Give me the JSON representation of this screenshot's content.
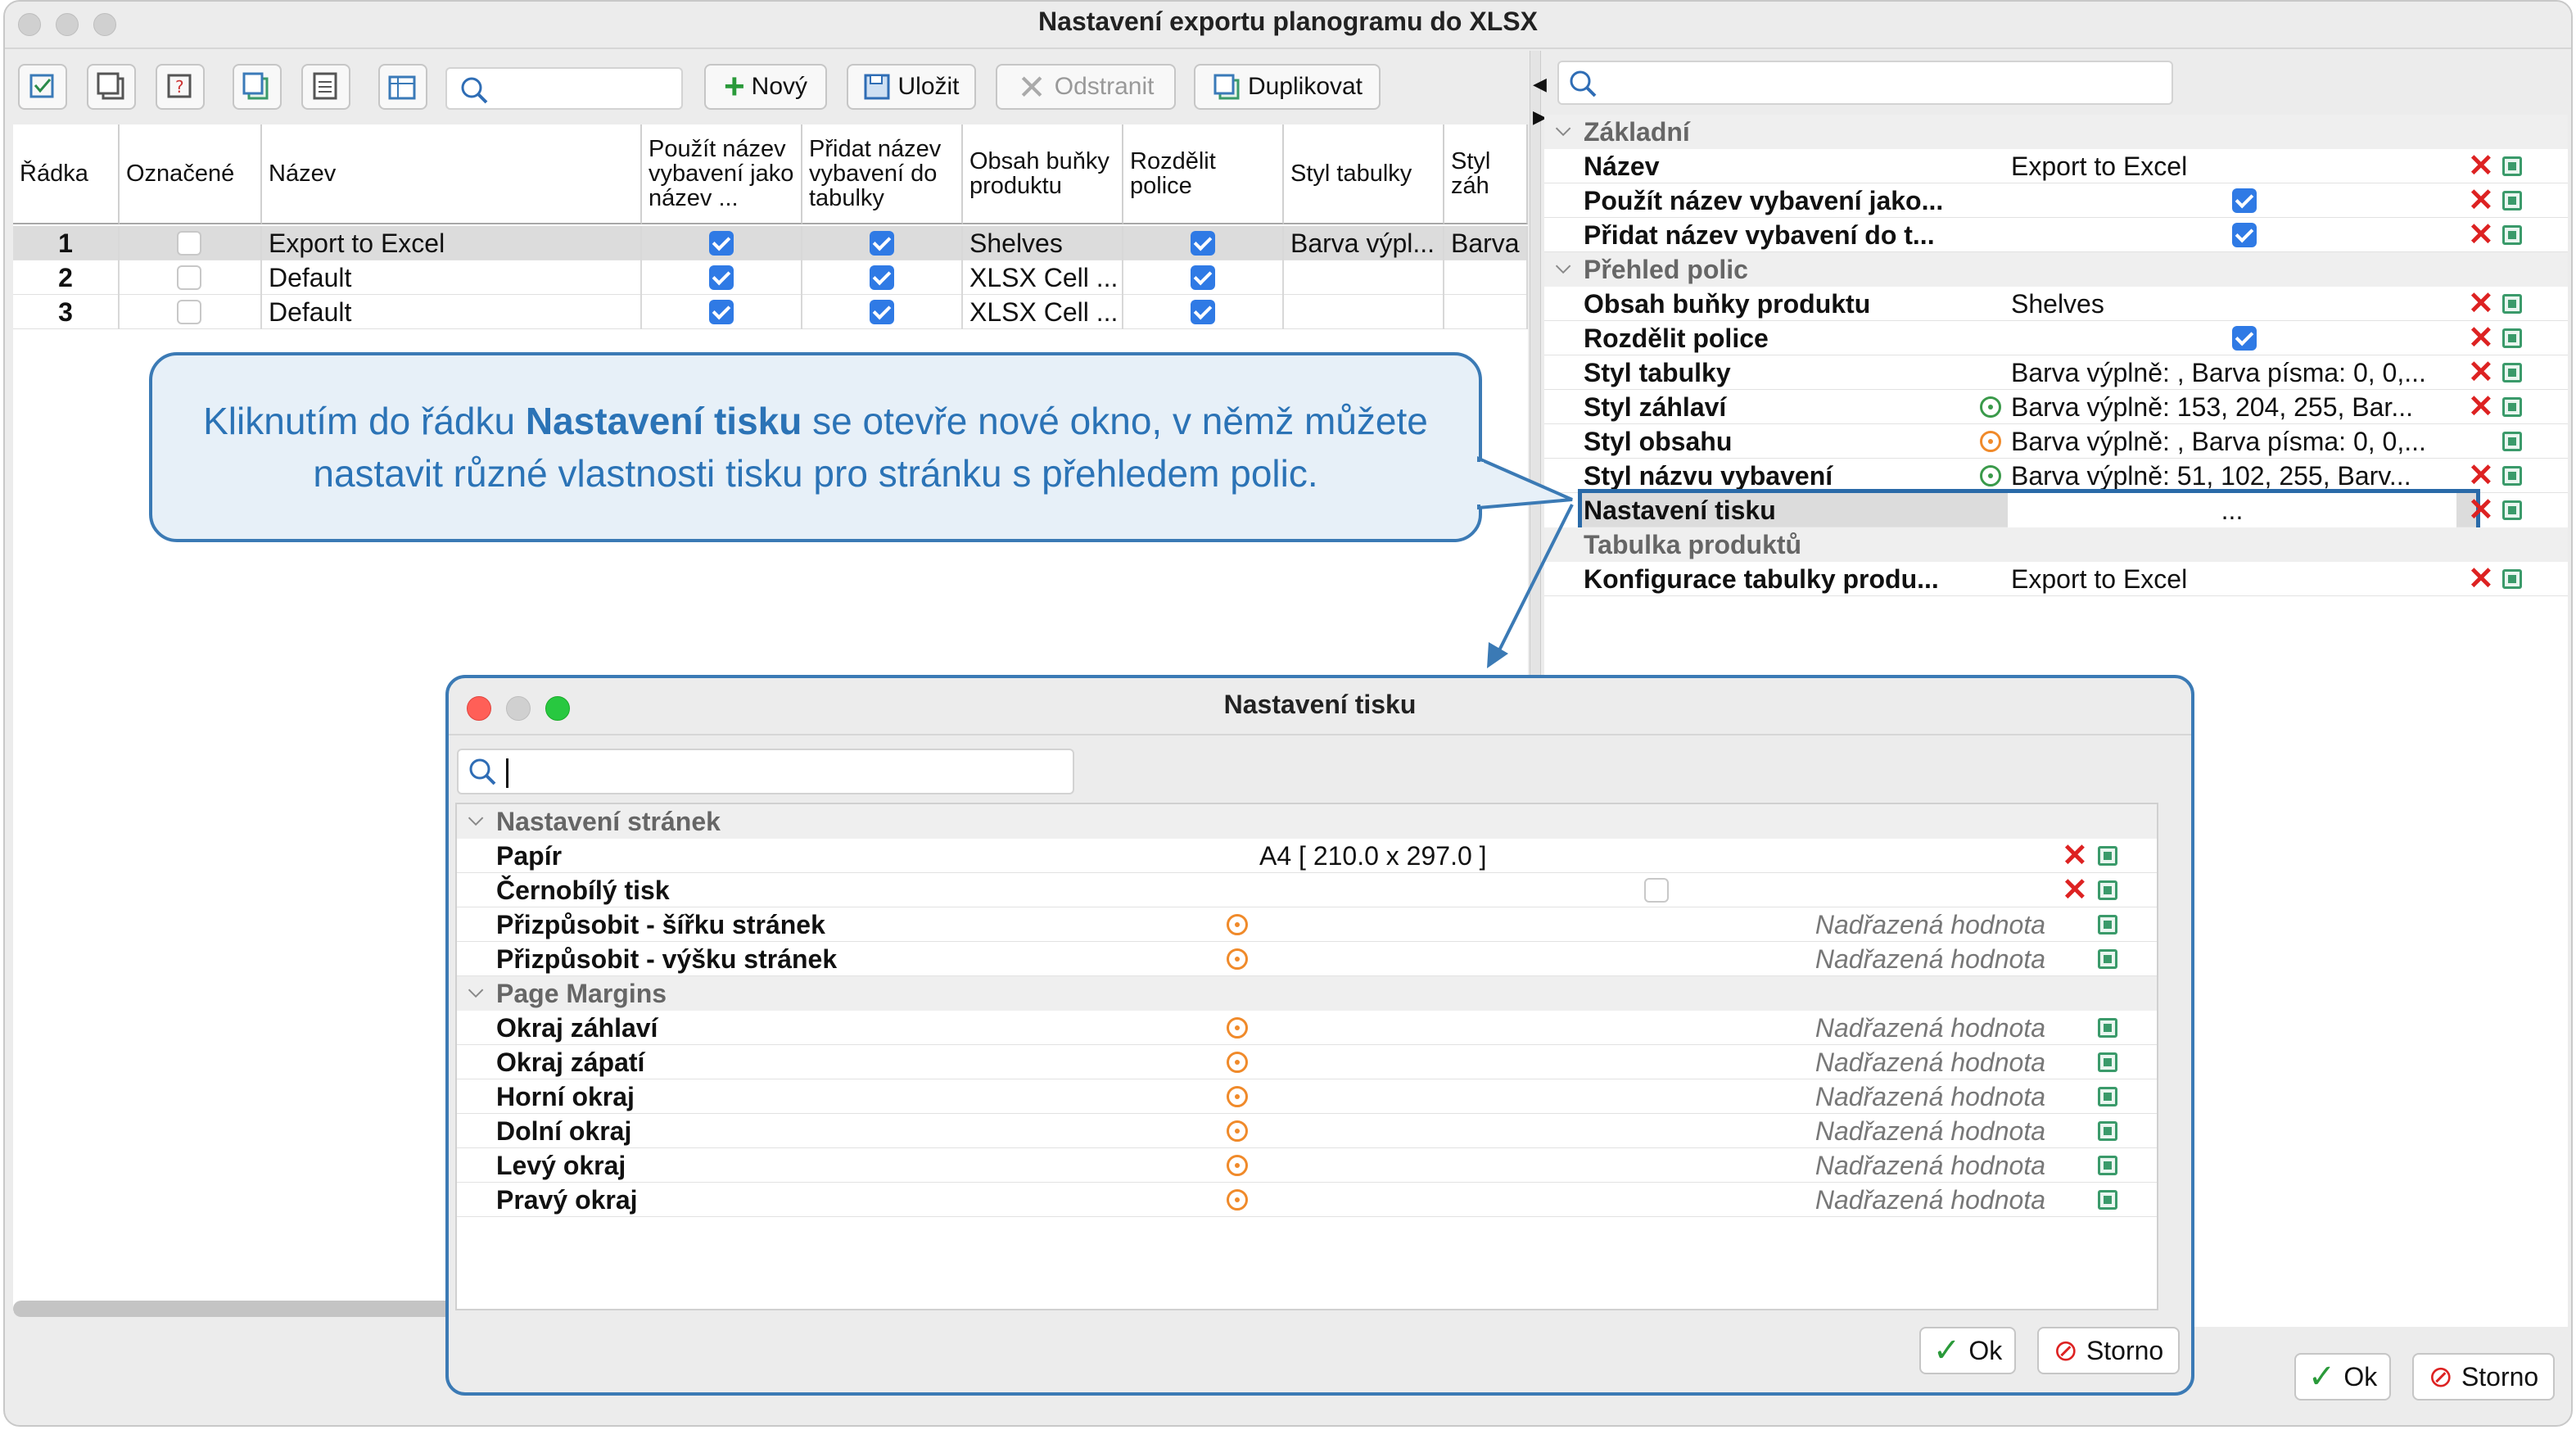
{
  "window": {
    "title": "Nastavení exportu planogramu do XLSX"
  },
  "toolbar": {
    "search_value": "",
    "new_label": "Nový",
    "save_label": "Uložit",
    "delete_label": "Odstranit",
    "duplicate_label": "Duplikovat"
  },
  "table": {
    "columns": [
      "Řádka",
      "Označené",
      "Název",
      "Použít název vybavení jako název ...",
      "Přidat název vybavení do tabulky",
      "Obsah buňky produktu",
      "Rozdělit police",
      "Styl tabulky",
      "Styl záh"
    ],
    "rows": [
      {
        "row": "1",
        "marked": false,
        "name": "Export to Excel",
        "use_name": true,
        "add_name": true,
        "content": "Shelves",
        "split": true,
        "style": "Barva výpl...",
        "header_style": "Barva v"
      },
      {
        "row": "2",
        "marked": false,
        "name": "Default",
        "use_name": true,
        "add_name": true,
        "content": "XLSX Cell ...",
        "split": true,
        "style": "",
        "header_style": ""
      },
      {
        "row": "3",
        "marked": false,
        "name": "Default",
        "use_name": true,
        "add_name": true,
        "content": "XLSX Cell ...",
        "split": true,
        "style": "",
        "header_style": ""
      }
    ]
  },
  "props": {
    "search_value": "",
    "sections": {
      "basic": "Základní",
      "overview": "Přehled polic",
      "products": "Tabulka produktů"
    },
    "items": [
      {
        "label": "Název",
        "value": "Export to Excel"
      },
      {
        "label": "Použít název vybavení jako...",
        "value": ""
      },
      {
        "label": "Přidat název vybavení do t...",
        "value": ""
      },
      {
        "label": "Obsah buňky produktu",
        "value": "Shelves"
      },
      {
        "label": "Rozdělit police",
        "value": ""
      },
      {
        "label": "Styl tabulky",
        "value": "Barva výplně: , Barva písma: 0, 0,..."
      },
      {
        "label": "Styl záhlaví",
        "value": "Barva výplně: 153, 204, 255, Bar..."
      },
      {
        "label": "Styl obsahu",
        "value": "Barva výplně: , Barva písma: 0, 0,..."
      },
      {
        "label": "Styl názvu vybavení",
        "value": "Barva výplně: 51, 102, 255, Barv..."
      },
      {
        "label": "Nastavení tisku",
        "value": "..."
      },
      {
        "label": "Konfigurace tabulky produ...",
        "value": "Export to Excel"
      }
    ]
  },
  "callout": {
    "pre": "Kliknutím do řádku ",
    "bold": "Nastavení tisku",
    "post": " se otevře nové okno, v němž můžete nastavit různé vlastnosti tisku pro stránku s přehledem polic."
  },
  "dialog": {
    "title": "Nastavení tisku",
    "search_value": "",
    "section_pages": "Nastavení stránek",
    "section_margins": "Page Margins",
    "paper_label": "Papír",
    "paper_value": "A4 [ 210.0 x 297.0 ]",
    "bw_label": "Černobílý tisk",
    "fit_width_label": "Přizpůsobit - šířku stránek",
    "fit_height_label": "Přizpůsobit - výšku stránek",
    "margin_labels": [
      "Okraj záhlaví",
      "Okraj zápatí",
      "Horní okraj",
      "Dolní okraj",
      "Levý okraj",
      "Pravý okraj"
    ],
    "inherited": "Nadřazená hodnota",
    "ok_label": "Ok",
    "cancel_label": "Storno"
  },
  "main_buttons": {
    "ok_label": "Ok",
    "cancel_label": "Storno"
  }
}
